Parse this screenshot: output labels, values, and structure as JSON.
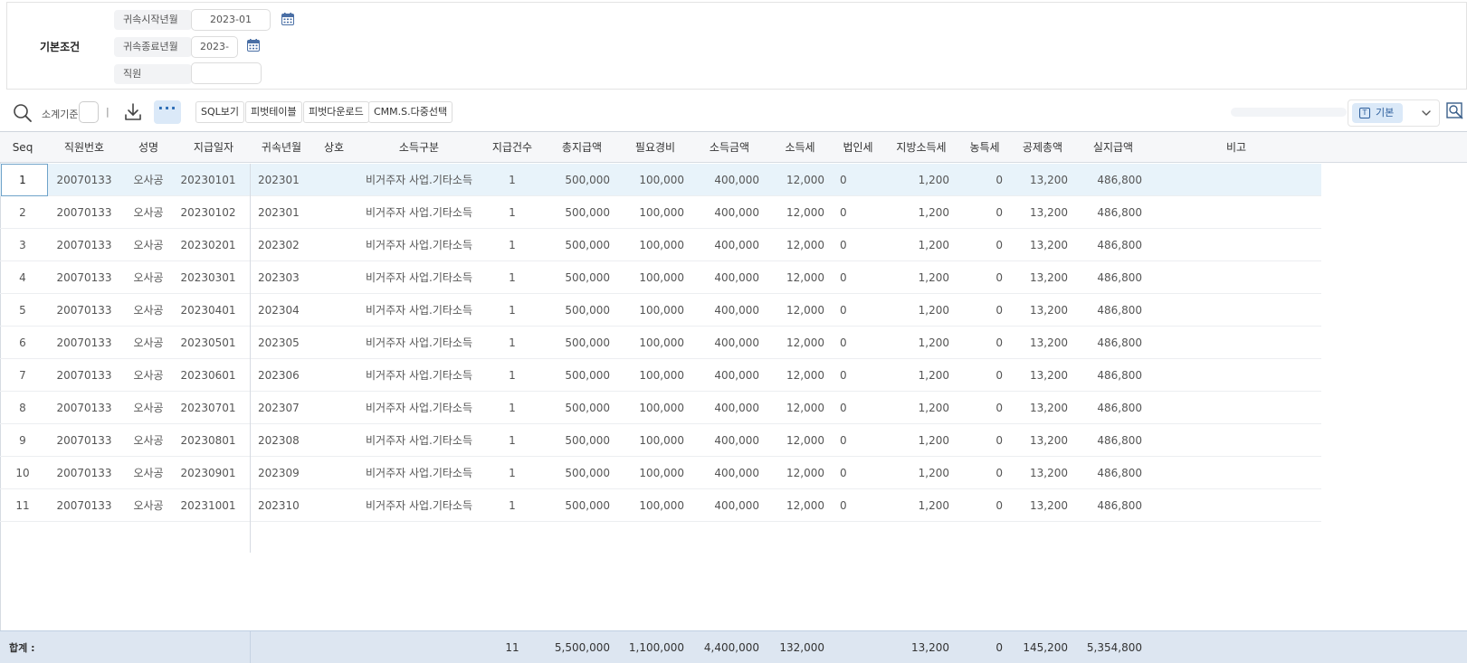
{
  "conditions": {
    "section_title": "기본조건",
    "start_month_label": "귀속시작년월",
    "start_month_value": "2023-01",
    "end_month_label": "귀속종료년월",
    "end_month_value": "2023-",
    "employee_label": "직원",
    "employee_value": ""
  },
  "toolbar": {
    "subtotal_label": "소계기준",
    "separator": "|",
    "more_label": "···",
    "sql_view": "SQL보기",
    "pivot_table": "피벗테이블",
    "pivot_download": "피벗다운로드",
    "multi_select": "CMM.S.다중선택",
    "view_label": "기본",
    "view_icon_glyph": "T"
  },
  "grid": {
    "columns": [
      "Seq",
      "직원번호",
      "성명",
      "지급일자",
      "귀속년월",
      "상호",
      "소득구분",
      "지급건수",
      "총지급액",
      "필요경비",
      "소득금액",
      "소득세",
      "법인세",
      "지방소득세",
      "농특세",
      "공제총액",
      "실지급액",
      "비고"
    ],
    "rows": [
      [
        "1",
        "20070133",
        "오사공",
        "20230101",
        "202301",
        "",
        "비거주자 사업.기타소득",
        "1",
        "500,000",
        "100,000",
        "400,000",
        "12,000",
        "0",
        "1,200",
        "0",
        "13,200",
        "486,800",
        ""
      ],
      [
        "2",
        "20070133",
        "오사공",
        "20230102",
        "202301",
        "",
        "비거주자 사업.기타소득",
        "1",
        "500,000",
        "100,000",
        "400,000",
        "12,000",
        "0",
        "1,200",
        "0",
        "13,200",
        "486,800",
        ""
      ],
      [
        "3",
        "20070133",
        "오사공",
        "20230201",
        "202302",
        "",
        "비거주자 사업.기타소득",
        "1",
        "500,000",
        "100,000",
        "400,000",
        "12,000",
        "0",
        "1,200",
        "0",
        "13,200",
        "486,800",
        ""
      ],
      [
        "4",
        "20070133",
        "오사공",
        "20230301",
        "202303",
        "",
        "비거주자 사업.기타소득",
        "1",
        "500,000",
        "100,000",
        "400,000",
        "12,000",
        "0",
        "1,200",
        "0",
        "13,200",
        "486,800",
        ""
      ],
      [
        "5",
        "20070133",
        "오사공",
        "20230401",
        "202304",
        "",
        "비거주자 사업.기타소득",
        "1",
        "500,000",
        "100,000",
        "400,000",
        "12,000",
        "0",
        "1,200",
        "0",
        "13,200",
        "486,800",
        ""
      ],
      [
        "6",
        "20070133",
        "오사공",
        "20230501",
        "202305",
        "",
        "비거주자 사업.기타소득",
        "1",
        "500,000",
        "100,000",
        "400,000",
        "12,000",
        "0",
        "1,200",
        "0",
        "13,200",
        "486,800",
        ""
      ],
      [
        "7",
        "20070133",
        "오사공",
        "20230601",
        "202306",
        "",
        "비거주자 사업.기타소득",
        "1",
        "500,000",
        "100,000",
        "400,000",
        "12,000",
        "0",
        "1,200",
        "0",
        "13,200",
        "486,800",
        ""
      ],
      [
        "8",
        "20070133",
        "오사공",
        "20230701",
        "202307",
        "",
        "비거주자 사업.기타소득",
        "1",
        "500,000",
        "100,000",
        "400,000",
        "12,000",
        "0",
        "1,200",
        "0",
        "13,200",
        "486,800",
        ""
      ],
      [
        "9",
        "20070133",
        "오사공",
        "20230801",
        "202308",
        "",
        "비거주자 사업.기타소득",
        "1",
        "500,000",
        "100,000",
        "400,000",
        "12,000",
        "0",
        "1,200",
        "0",
        "13,200",
        "486,800",
        ""
      ],
      [
        "10",
        "20070133",
        "오사공",
        "20230901",
        "202309",
        "",
        "비거주자 사업.기타소득",
        "1",
        "500,000",
        "100,000",
        "400,000",
        "12,000",
        "0",
        "1,200",
        "0",
        "13,200",
        "486,800",
        ""
      ],
      [
        "11",
        "20070133",
        "오사공",
        "20231001",
        "202310",
        "",
        "비거주자 사업.기타소득",
        "1",
        "500,000",
        "100,000",
        "400,000",
        "12,000",
        "0",
        "1,200",
        "0",
        "13,200",
        "486,800",
        ""
      ]
    ],
    "selected_row": 0,
    "footer": {
      "label": "합계 :",
      "count": "11",
      "total_pay": "5,500,000",
      "expenses": "1,100,000",
      "income": "4,400,000",
      "income_tax": "132,000",
      "local_tax": "13,200",
      "rural_tax": "0",
      "deduction_total": "145,200",
      "net_pay": "5,354,800"
    }
  },
  "colors": {
    "accent": "#2b6cb5",
    "selected_row": "#e8f3fa",
    "footer_bg": "#dde6f1",
    "calendar_icon": "#4a6fa5"
  }
}
